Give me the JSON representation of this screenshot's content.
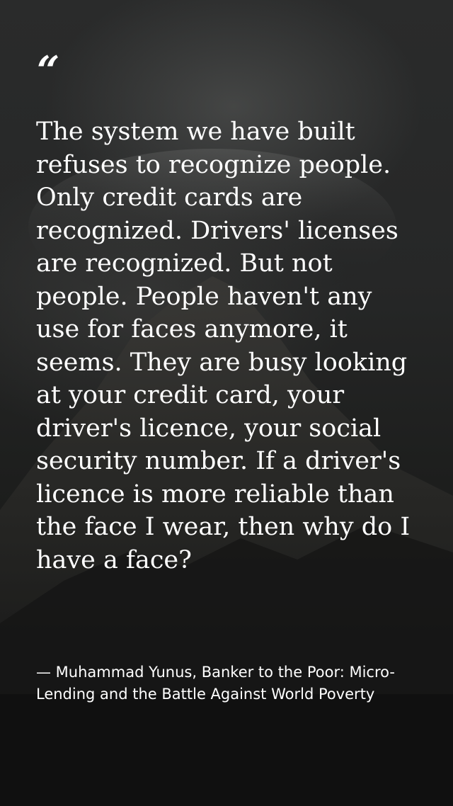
{
  "quote": {
    "mark": "“",
    "text": "The system we have built refuses to recognize people. Only credit cards are recognized. Drivers' licenses are recognized. But not people. People haven't any use for faces anymore, it seems. They are busy looking at your credit card, your driver's licence, your social security number. If a driver's licence is more reliable than the face I wear, then why do I have a face?",
    "attribution": "— Muhammad Yunus, Banker to the Poor: Micro-Lending and the Battle Against World Poverty"
  }
}
